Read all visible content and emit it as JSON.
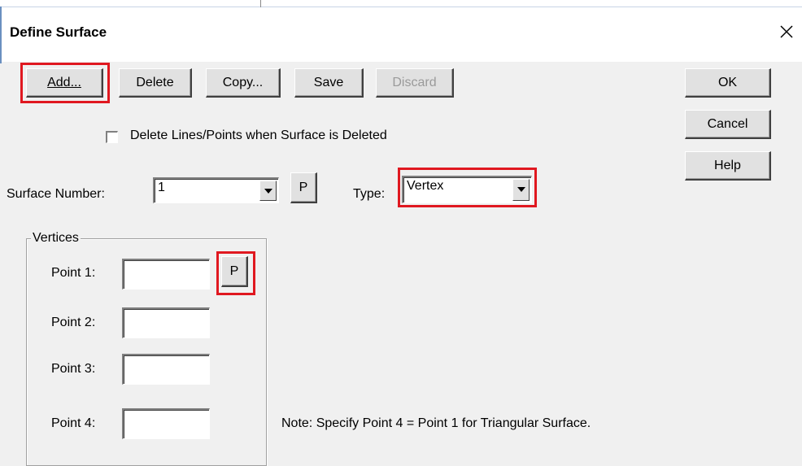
{
  "window": {
    "title": "Define Surface",
    "close_icon": "close-icon"
  },
  "toolbar": {
    "add_label": "Add...",
    "delete_label": "Delete",
    "copy_label": "Copy...",
    "save_label": "Save",
    "discard_label": "Discard"
  },
  "side_buttons": {
    "ok_label": "OK",
    "cancel_label": "Cancel",
    "help_label": "Help"
  },
  "options": {
    "delete_lines_label": "Delete Lines/Points when Surface is Deleted",
    "delete_lines_checked": false
  },
  "surface": {
    "number_label": "Surface Number:",
    "number_value": "1",
    "pick_label": "P",
    "type_label": "Type:",
    "type_value": "Vertex"
  },
  "vertices": {
    "group_label": "Vertices",
    "points": [
      {
        "label": "Point 1:",
        "value": ""
      },
      {
        "label": "Point 2:",
        "value": ""
      },
      {
        "label": "Point 3:",
        "value": ""
      },
      {
        "label": "Point 4:",
        "value": ""
      }
    ],
    "pick_label": "P"
  },
  "note": "Note: Specify Point 4 = Point 1 for Triangular Surface.",
  "highlight_color": "#e01820"
}
